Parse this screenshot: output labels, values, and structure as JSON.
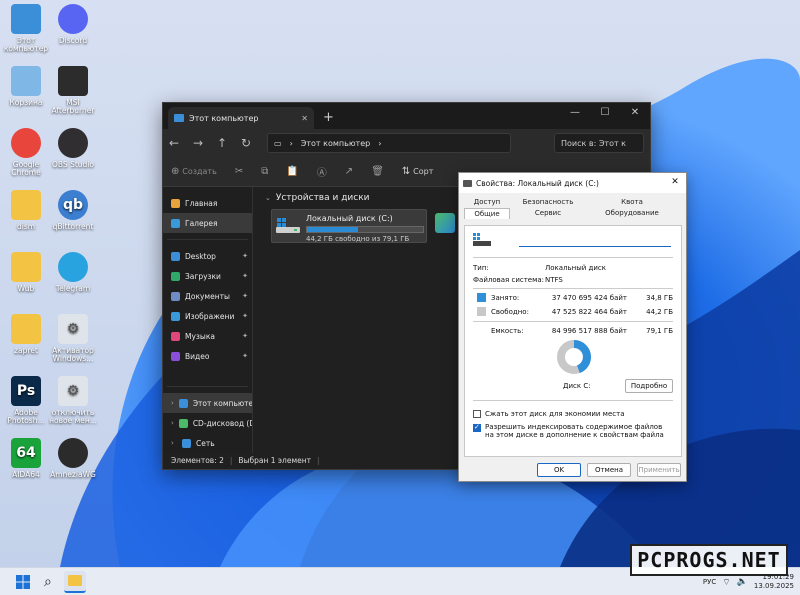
{
  "desktop": {
    "icons": [
      {
        "label": "Этот компьютер",
        "icon": "monitor-icon",
        "color": "#3a8fd8"
      },
      {
        "label": "Discord",
        "icon": "discord-icon",
        "color": "#5865f2"
      },
      {
        "label": "Корзина",
        "icon": "recycle-bin-icon",
        "color": "#7fb7e6"
      },
      {
        "label": "MSI Afterburner",
        "icon": "afterburner-icon",
        "color": "#2c2c2c"
      },
      {
        "label": "Google Chrome",
        "icon": "chrome-icon",
        "color": "#e8453c"
      },
      {
        "label": "OBS Studio",
        "icon": "obs-icon",
        "color": "#302e31"
      },
      {
        "label": "dism",
        "icon": "folder-icon",
        "color": "#f3c443"
      },
      {
        "label": "qBittorrent",
        "icon": "qbittorrent-icon",
        "color": "#3c7ed0"
      },
      {
        "label": "Wub",
        "icon": "folder-icon",
        "color": "#f3c443"
      },
      {
        "label": "Telegram",
        "icon": "telegram-icon",
        "color": "#29a3e0"
      },
      {
        "label": "zapret",
        "icon": "folder-icon",
        "color": "#f3c443"
      },
      {
        "label": "Активатор Windows...",
        "icon": "gear-icon",
        "color": "#dfe4ea"
      },
      {
        "label": "Adobe Photosh...",
        "icon": "photoshop-icon",
        "color": "#0b2a4a"
      },
      {
        "label": "отключить новое мен...",
        "icon": "gear-icon",
        "color": "#dfe4ea"
      },
      {
        "label": "AIDA64",
        "icon": "aida64-icon",
        "color": "#19a33a"
      },
      {
        "label": "AmneziaWG",
        "icon": "amneziawg-icon",
        "color": "#2b2b2b"
      }
    ],
    "icon_glyphs": {
      "photoshop": "Ps",
      "qbittorrent": "qb",
      "aida": "64"
    }
  },
  "explorer": {
    "tab_title": "Этот компьютер",
    "address": "Этот компьютер",
    "search_placeholder": "Поиск в: Этот к",
    "toolbar": {
      "create": "Создать",
      "sort": "Сорт"
    },
    "sidebar_top": [
      {
        "label": "Главная",
        "icon": "home-icon",
        "color": "#e8a33c"
      },
      {
        "label": "Галерея",
        "icon": "gallery-icon",
        "color": "#3a9ad9"
      }
    ],
    "sidebar_pinned": [
      {
        "label": "Desktop",
        "icon": "desktop-icon",
        "color": "#3a8fd8"
      },
      {
        "label": "Загрузки",
        "icon": "downloads-icon",
        "color": "#2fa86a"
      },
      {
        "label": "Документы",
        "icon": "documents-icon",
        "color": "#6c8ec4"
      },
      {
        "label": "Изображени",
        "icon": "pictures-icon",
        "color": "#3a9ad9"
      },
      {
        "label": "Музыка",
        "icon": "music-icon",
        "color": "#e0467c"
      },
      {
        "label": "Видео",
        "icon": "videos-icon",
        "color": "#8a4fd8"
      }
    ],
    "sidebar_bottom": [
      {
        "label": "Этот компьютер",
        "icon": "monitor-icon",
        "color": "#3a8fd8"
      },
      {
        "label": "CD-дисковод (D",
        "icon": "cd-drive-icon",
        "color": "#4bb86a"
      },
      {
        "label": "Сеть",
        "icon": "network-icon",
        "color": "#3a8fd8"
      }
    ],
    "group_header": "Устройства и диски",
    "drive": {
      "name": "Локальный диск (C:)",
      "free_text": "44,2 ГБ свободно из 79,1 ГБ",
      "used_fraction": 0.442
    },
    "status": {
      "items": "Элементов: 2",
      "selected": "Выбран 1 элемент"
    }
  },
  "properties": {
    "title": "Свойства: Локальный диск (C:)",
    "tabs_row1": [
      "Доступ",
      "Безопасность",
      "Квота"
    ],
    "tabs_row2": [
      "Общие",
      "Сервис",
      "Оборудование"
    ],
    "active_tab": "Общие",
    "name_value": "",
    "type_label": "Тип:",
    "type_value": "Локальный диск",
    "fs_label": "Файловая система:",
    "fs_value": "NTFS",
    "used_label": "Занято:",
    "used_bytes": "37 470 695 424 байт",
    "used_gb": "34,8 ГБ",
    "free_label": "Свободно:",
    "free_bytes": "47 525 822 464 байт",
    "free_gb": "44,2 ГБ",
    "cap_label": "Емкость:",
    "cap_bytes": "84 996 517 888 байт",
    "cap_gb": "79,1 ГБ",
    "used_fraction": 0.441,
    "used_color": "#2f8fd8",
    "free_color": "#c8c8c8",
    "disk_label": "Диск C:",
    "details_button": "Подробно",
    "compress_label": "Сжать этот диск для экономии места",
    "compress_checked": false,
    "index_label": "Разрешить индексировать содержимое файлов на этом диске в дополнение к свойствам файла",
    "index_checked": true,
    "ok": "OK",
    "cancel": "Отмена",
    "apply": "Применить"
  },
  "taskbar": {
    "lang": "РУС",
    "time": "19:01:29",
    "date": "13.09.2025"
  },
  "watermark": "PCPROGS.NET"
}
